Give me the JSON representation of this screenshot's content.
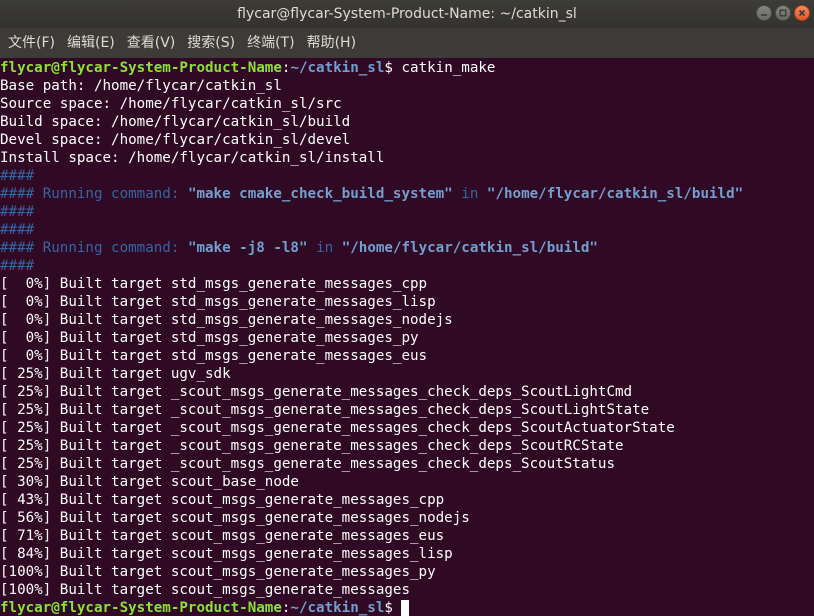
{
  "window": {
    "title": "flycar@flycar-System-Product-Name: ~/catkin_sl"
  },
  "menubar": {
    "items": [
      {
        "label": "文件(F)"
      },
      {
        "label": "编辑(E)"
      },
      {
        "label": "查看(V)"
      },
      {
        "label": "搜索(S)"
      },
      {
        "label": "终端(T)"
      },
      {
        "label": "帮助(H)"
      }
    ]
  },
  "terminal": {
    "prompt": {
      "user_host": "flycar@flycar-System-Product-Name",
      "sep": ":",
      "path": "~/catkin_sl",
      "symbol": "$ ",
      "command": "catkin_make"
    },
    "info_lines": [
      "Base path: /home/flycar/catkin_sl",
      "Source space: /home/flycar/catkin_sl/src",
      "Build space: /home/flycar/catkin_sl/build",
      "Devel space: /home/flycar/catkin_sl/devel",
      "Install space: /home/flycar/catkin_sl/install"
    ],
    "hash": "####",
    "hash_prefix": "#### ",
    "running_label": "Running command: ",
    "in_label": " in ",
    "cmd1": "\"make cmake_check_build_system\"",
    "dir1": "\"/home/flycar/catkin_sl/build\"",
    "cmd2": "\"make -j8 -l8\"",
    "dir2": "\"/home/flycar/catkin_sl/build\"",
    "build_lines": [
      "[  0%] Built target std_msgs_generate_messages_cpp",
      "[  0%] Built target std_msgs_generate_messages_lisp",
      "[  0%] Built target std_msgs_generate_messages_nodejs",
      "[  0%] Built target std_msgs_generate_messages_py",
      "[  0%] Built target std_msgs_generate_messages_eus",
      "[ 25%] Built target ugv_sdk",
      "[ 25%] Built target _scout_msgs_generate_messages_check_deps_ScoutLightCmd",
      "[ 25%] Built target _scout_msgs_generate_messages_check_deps_ScoutLightState",
      "[ 25%] Built target _scout_msgs_generate_messages_check_deps_ScoutActuatorState",
      "[ 25%] Built target _scout_msgs_generate_messages_check_deps_ScoutRCState",
      "[ 25%] Built target _scout_msgs_generate_messages_check_deps_ScoutStatus",
      "[ 30%] Built target scout_base_node",
      "[ 43%] Built target scout_msgs_generate_messages_cpp",
      "[ 56%] Built target scout_msgs_generate_messages_nodejs",
      "[ 71%] Built target scout_msgs_generate_messages_eus",
      "[ 84%] Built target scout_msgs_generate_messages_lisp",
      "[100%] Built target scout_msgs_generate_messages_py",
      "[100%] Built target scout_msgs_generate_messages"
    ]
  }
}
